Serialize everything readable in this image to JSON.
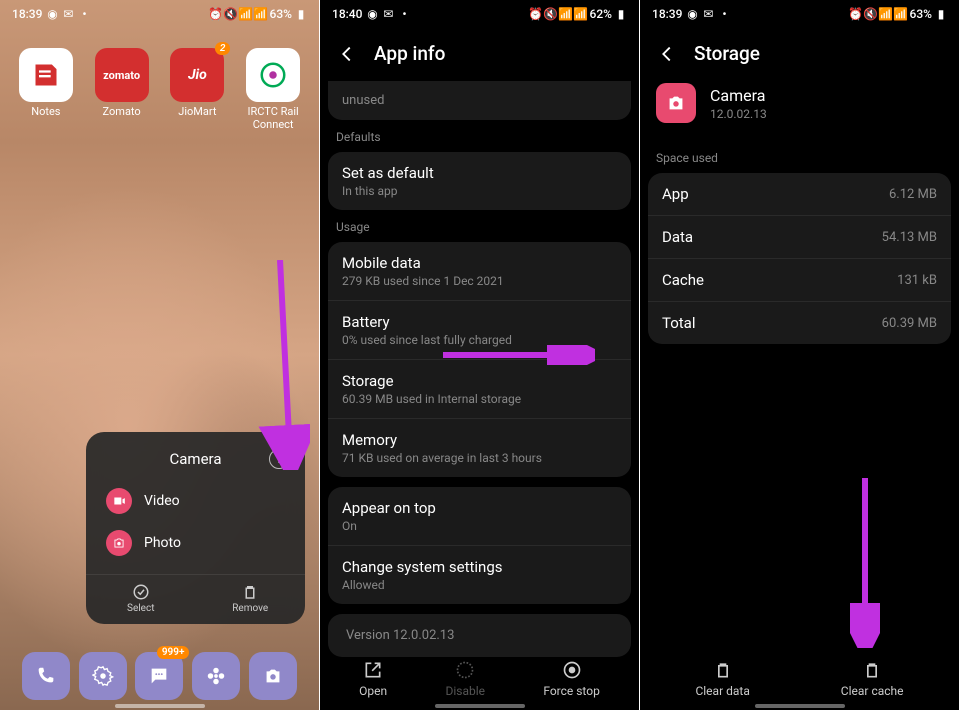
{
  "panel1": {
    "status": {
      "time": "18:39",
      "battery": "63%"
    },
    "apps": [
      {
        "label": "Notes",
        "bg": "#fff",
        "accent": "#d32f2f"
      },
      {
        "label": "Zomato",
        "bg": "#d32f2f",
        "accent": "#fff"
      },
      {
        "label": "JioMart",
        "bg": "#d32f2f",
        "accent": "#fff",
        "badge": "2"
      },
      {
        "label": "IRCTC Rail Connect",
        "bg": "#fff",
        "accent": "#0a5"
      }
    ],
    "ctx": {
      "title": "Camera",
      "items": [
        {
          "label": "Video"
        },
        {
          "label": "Photo"
        }
      ],
      "actions": [
        {
          "label": "Select"
        },
        {
          "label": "Remove"
        }
      ]
    },
    "dock_badge": "999+"
  },
  "panel2": {
    "status": {
      "time": "18:40",
      "battery": "62%"
    },
    "title": "App info",
    "truncated_row": "unused",
    "sections": {
      "defaults": {
        "title": "Defaults"
      },
      "usage": {
        "title": "Usage"
      }
    },
    "rows": {
      "setDefault": {
        "t": "Set as default",
        "s": "In this app"
      },
      "mobileData": {
        "t": "Mobile data",
        "s": "279 KB used since 1 Dec 2021"
      },
      "battery": {
        "t": "Battery",
        "s": "0% used since last fully charged"
      },
      "storage": {
        "t": "Storage",
        "s": "60.39 MB used in Internal storage"
      },
      "memory": {
        "t": "Memory",
        "s": "71 KB used on average in last 3 hours"
      },
      "appearOnTop": {
        "t": "Appear on top",
        "s": "On"
      },
      "changeSys": {
        "t": "Change system settings",
        "s": "Allowed"
      }
    },
    "version": "Version 12.0.02.13",
    "actions": {
      "open": "Open",
      "disable": "Disable",
      "forceStop": "Force stop"
    }
  },
  "panel3": {
    "status": {
      "time": "18:39",
      "battery": "63%"
    },
    "title": "Storage",
    "app": {
      "name": "Camera",
      "version": "12.0.02.13"
    },
    "spaceUsedLabel": "Space used",
    "rows": [
      {
        "k": "App",
        "v": "6.12 MB"
      },
      {
        "k": "Data",
        "v": "54.13 MB"
      },
      {
        "k": "Cache",
        "v": "131 kB"
      },
      {
        "k": "Total",
        "v": "60.39 MB"
      }
    ],
    "actions": {
      "clearData": "Clear data",
      "clearCache": "Clear cache"
    }
  }
}
